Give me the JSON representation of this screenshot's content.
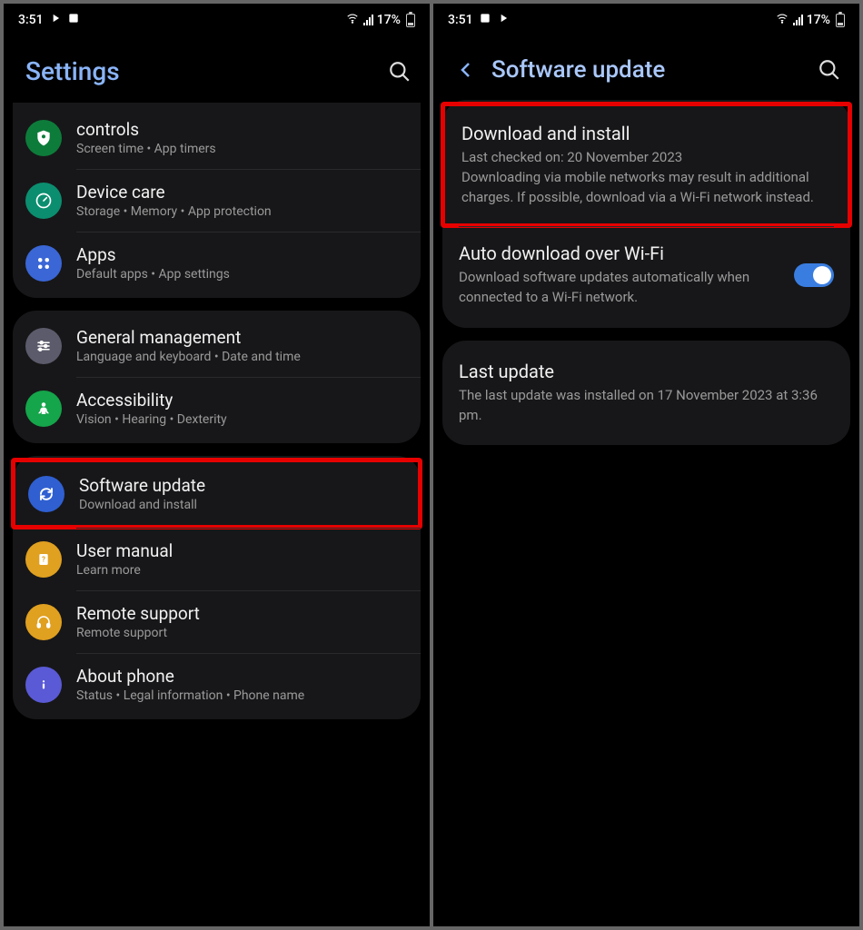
{
  "status": {
    "time": "3:51",
    "battery_pct": "17%"
  },
  "left": {
    "title": "Settings",
    "groups": [
      {
        "items": [
          {
            "title": "controls",
            "subtitle": "Screen time  •  App timers",
            "icon_bg": "#0d7c3a",
            "icon": "shield"
          },
          {
            "title": "Device care",
            "subtitle": "Storage  •  Memory  •  App protection",
            "icon_bg": "#0b8e6f",
            "icon": "gauge"
          },
          {
            "title": "Apps",
            "subtitle": "Default apps  •  App settings",
            "icon_bg": "#3a66d6",
            "icon": "grid4"
          }
        ]
      },
      {
        "items": [
          {
            "title": "General management",
            "subtitle": "Language and keyboard  •  Date and time",
            "icon_bg": "#5b5b6b",
            "icon": "sliders"
          },
          {
            "title": "Accessibility",
            "subtitle": "Vision  •  Hearing  •  Dexterity",
            "icon_bg": "#15a54a",
            "icon": "person"
          }
        ]
      },
      {
        "items": [
          {
            "title": "Software update",
            "subtitle": "Download and install",
            "icon_bg": "#2f5fd1",
            "icon": "refresh",
            "highlight": true
          },
          {
            "title": "User manual",
            "subtitle": "Learn more",
            "icon_bg": "#e0a020",
            "icon": "book"
          },
          {
            "title": "Remote support",
            "subtitle": "Remote support",
            "icon_bg": "#e0a020",
            "icon": "headset"
          },
          {
            "title": "About phone",
            "subtitle": "Status  •  Legal information  •  Phone name",
            "icon_bg": "#5a5ad6",
            "icon": "info"
          }
        ]
      }
    ]
  },
  "right": {
    "title": "Software update",
    "card1": {
      "download": {
        "title": "Download and install",
        "line1": "Last checked on: 20 November 2023",
        "line2": "Downloading via mobile networks may result in additional charges. If possible, download via a Wi-Fi network instead.",
        "highlight": true
      },
      "auto": {
        "title": "Auto download over Wi-Fi",
        "sub": "Download software updates automatically when connected to a Wi-Fi network.",
        "toggle_on": true
      }
    },
    "card2": {
      "last": {
        "title": "Last update",
        "sub": "The last update was installed on 17 November 2023 at 3:36 pm."
      }
    }
  },
  "icons": {
    "search": "search-icon",
    "back": "chevron-left-icon"
  }
}
